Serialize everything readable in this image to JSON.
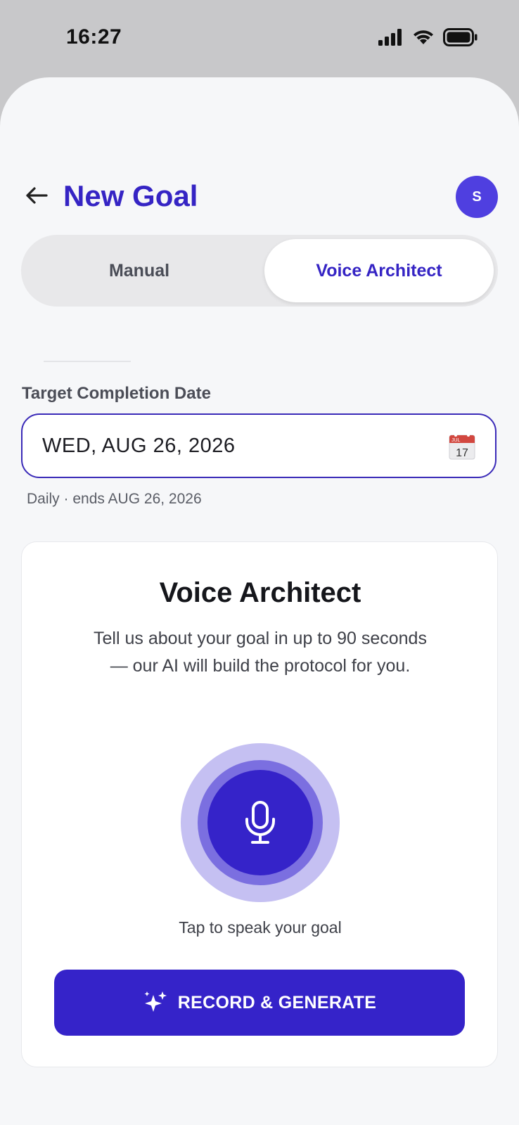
{
  "status": {
    "time": "16:27"
  },
  "header": {
    "title": "New Goal",
    "avatar_initial": "S"
  },
  "tabs": [
    {
      "label": "Manual",
      "active": false
    },
    {
      "label": "Voice Architect",
      "active": true
    }
  ],
  "date": {
    "label": "Target Completion Date",
    "value": "WED, AUG 26, 2026",
    "hint": "Daily · ends AUG 26, 2026",
    "calendar_icon": {
      "month": "JUL",
      "day": "17"
    }
  },
  "voice_card": {
    "title": "Voice Architect",
    "description": "Tell us about your goal in up to 90 seconds — our AI will build the protocol for you.",
    "mic_caption": "Tap to speak your goal",
    "button_label": "RECORD & GENERATE"
  },
  "colors": {
    "accent": "#3523c9",
    "title": "#3524c4",
    "avatar": "#4f3fe0",
    "mic_ring_outer": "#c5c0f2",
    "mic_ring_mid": "#7b6fe0"
  },
  "icons": [
    "signal-icon",
    "wifi-icon",
    "battery-icon",
    "back-arrow-icon",
    "calendar-icon",
    "microphone-icon",
    "sparkles-icon"
  ]
}
